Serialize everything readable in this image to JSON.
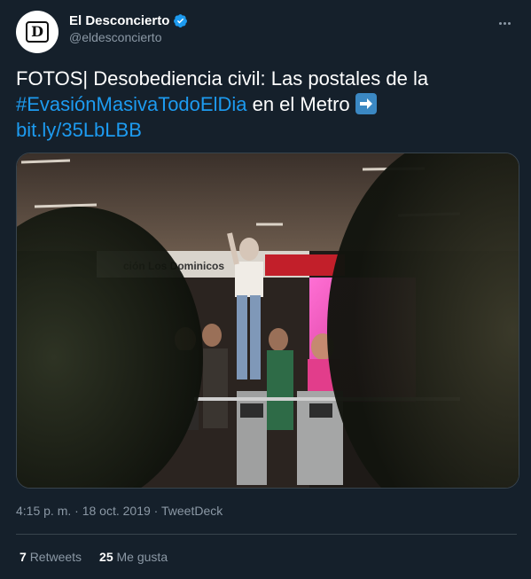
{
  "author": {
    "display_name": "El Desconcierto",
    "handle": "@eldesconcierto",
    "avatar_letter": "D",
    "verified": true
  },
  "tweet": {
    "text_part1": "FOTOS| Desobediencia civil: Las postales de la",
    "hashtag": "#EvasiónMasivaTodoElDia",
    "text_part2": " en el Metro ",
    "emoji": "right-arrow-emoji",
    "link": "bit.ly/35LbLBB"
  },
  "photo": {
    "station_sign": "ción Los Dominicos"
  },
  "meta": {
    "time": "4:15 p. m.",
    "separator": " · ",
    "date": "18 oct. 2019",
    "source": "TweetDeck"
  },
  "stats": {
    "retweets_count": "7",
    "retweets_label": "Retweets",
    "likes_count": "25",
    "likes_label": "Me gusta"
  },
  "colors": {
    "background": "#15202b",
    "link": "#1d9bf0",
    "secondary_text": "#8b98a5",
    "divider": "#38444d",
    "verified": "#1d9bf0"
  }
}
